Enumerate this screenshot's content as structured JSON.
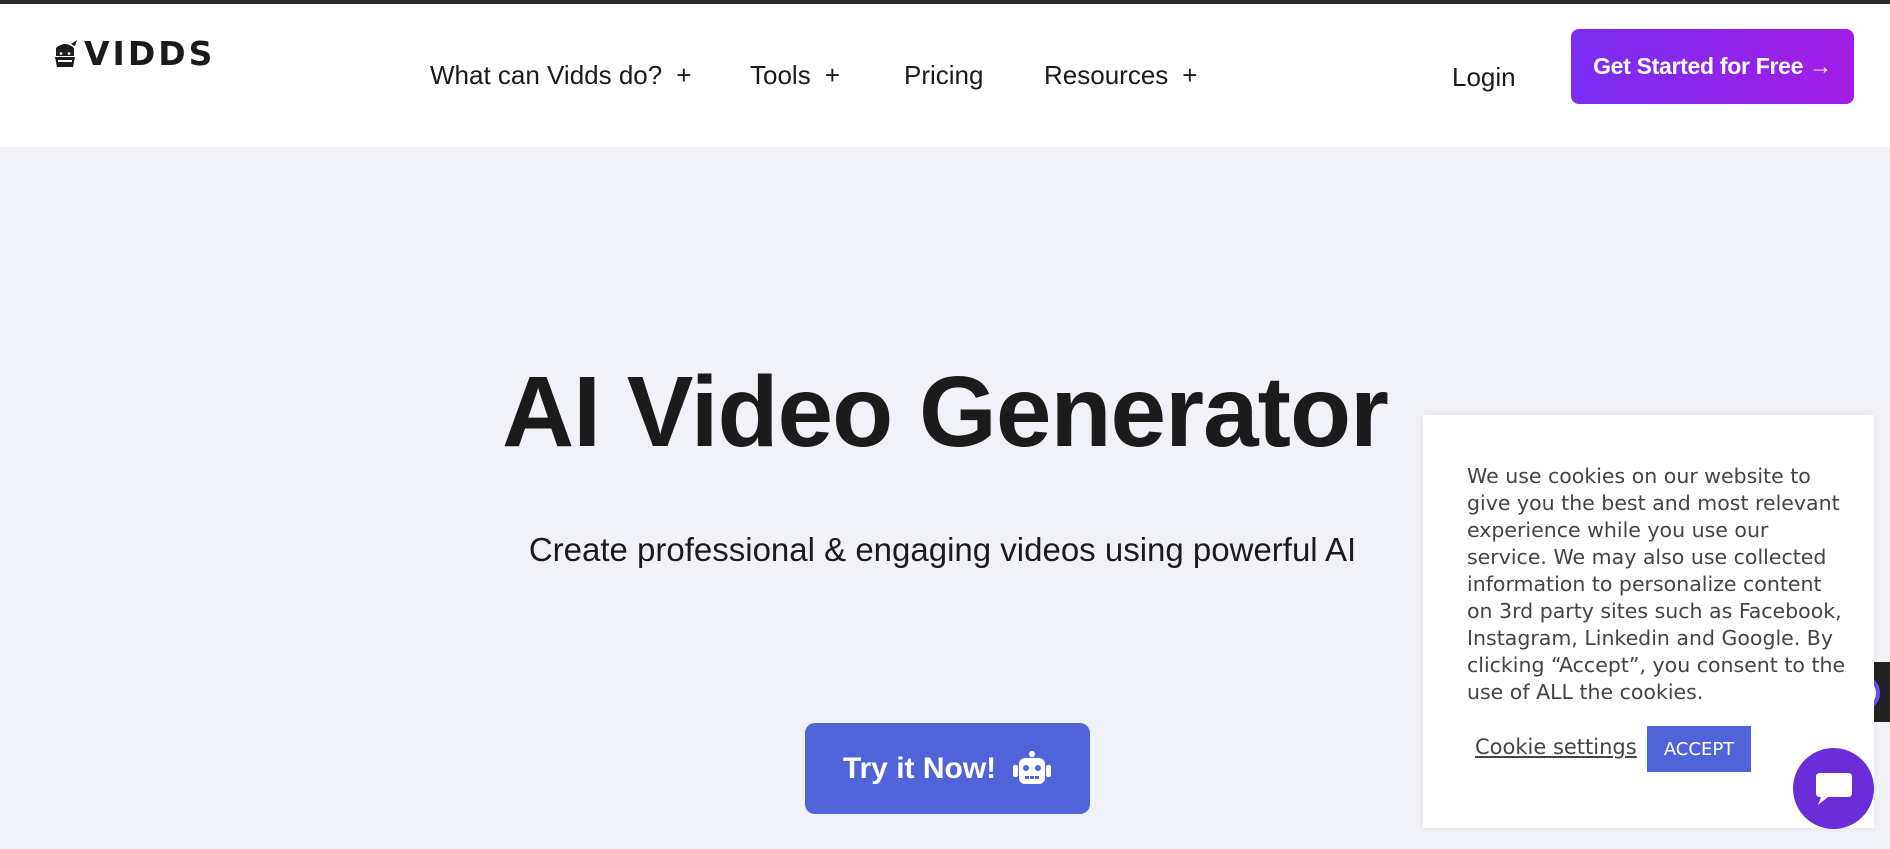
{
  "header": {
    "logo_text": "VIDDS",
    "nav": [
      {
        "label": "What can Vidds do?",
        "has_dropdown": true,
        "plus": "+"
      },
      {
        "label": "Tools",
        "has_dropdown": true,
        "plus": "+"
      },
      {
        "label": "Pricing",
        "has_dropdown": false,
        "plus": ""
      },
      {
        "label": "Resources",
        "has_dropdown": true,
        "plus": "+"
      }
    ],
    "login_label": "Login",
    "cta_label": "Get Started for Free →"
  },
  "hero": {
    "title": "AI Video Generator",
    "subtitle": "Create professional & engaging videos using powerful AI",
    "button_label": "Try it Now!"
  },
  "cookie_banner": {
    "text": "We use cookies on our website to give you the best and most relevant experience while you use our service. We may also use collected information to personalize content on 3rd party sites such as Facebook, Instagram, Linkedin and Google. By clicking “Accept”, you consent to the use of ALL the cookies.",
    "settings_label": "Cookie settings",
    "accept_label": "ACCEPT"
  },
  "colors": {
    "cta_gradient_start": "#7a2df0",
    "cta_gradient_end": "#a21de6",
    "primary_button": "#5063d9",
    "chat_button": "#6a2ed8",
    "page_bg": "#f1f2f7"
  },
  "icons": {
    "logo": "ninja-logo-icon",
    "hero_button": "robot-icon",
    "chat": "chat-bubble-icon",
    "side_widget": "assistant-face-icon"
  }
}
